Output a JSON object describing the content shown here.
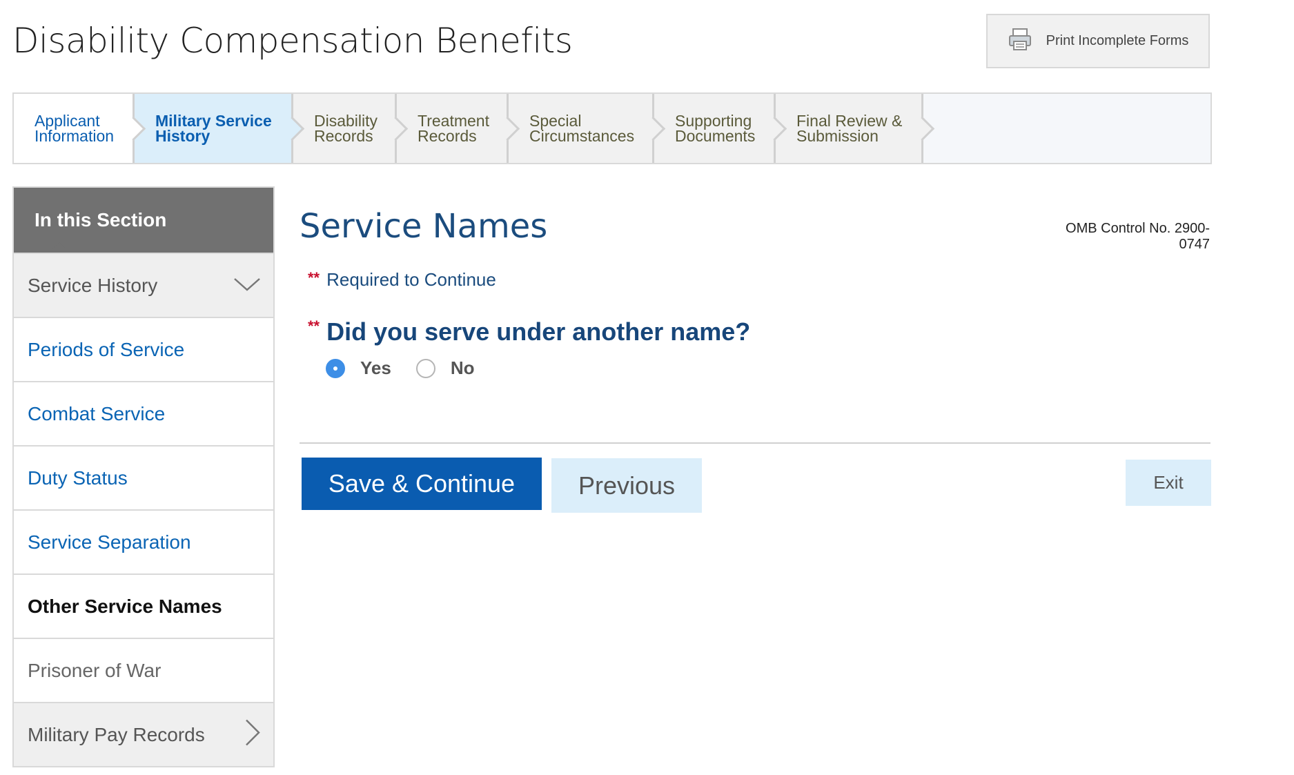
{
  "header": {
    "title": "Disability Compensation Benefits",
    "print_label": "Print Incomplete Forms"
  },
  "steps": [
    {
      "line1": "Applicant",
      "line2": "Information",
      "state": "done"
    },
    {
      "line1": "Military Service",
      "line2": "History",
      "state": "active"
    },
    {
      "line1": "Disability",
      "line2": "Records",
      "state": "pending"
    },
    {
      "line1": "Treatment",
      "line2": "Records",
      "state": "pending"
    },
    {
      "line1": "Special",
      "line2": "Circumstances",
      "state": "pending"
    },
    {
      "line1": "Supporting",
      "line2": "Documents",
      "state": "pending"
    },
    {
      "line1": "Final Review &",
      "line2": "Submission",
      "state": "pending"
    }
  ],
  "sidebar": {
    "heading": "In this Section",
    "items": [
      {
        "label": "Service History"
      },
      {
        "label": "Periods of Service"
      },
      {
        "label": "Combat Service"
      },
      {
        "label": "Duty Status"
      },
      {
        "label": "Service Separation"
      },
      {
        "label": "Other Service Names"
      },
      {
        "label": "Prisoner of War"
      },
      {
        "label": "Military Pay Records"
      }
    ]
  },
  "main": {
    "section_title": "Service Names",
    "omb": "OMB Control No. 2900-0747",
    "required_marker": "**",
    "required_note": "Required to Continue",
    "question": "Did you serve under another name?",
    "options": [
      {
        "label": "Yes",
        "selected": true
      },
      {
        "label": "No",
        "selected": false
      }
    ],
    "save_label": "Save & Continue",
    "previous_label": "Previous",
    "exit_label": "Exit"
  },
  "colors": {
    "primary": "#0a5cb0",
    "active_tab": "#dbeefa",
    "required": "#c8102e",
    "heading": "#1b4c7e"
  }
}
